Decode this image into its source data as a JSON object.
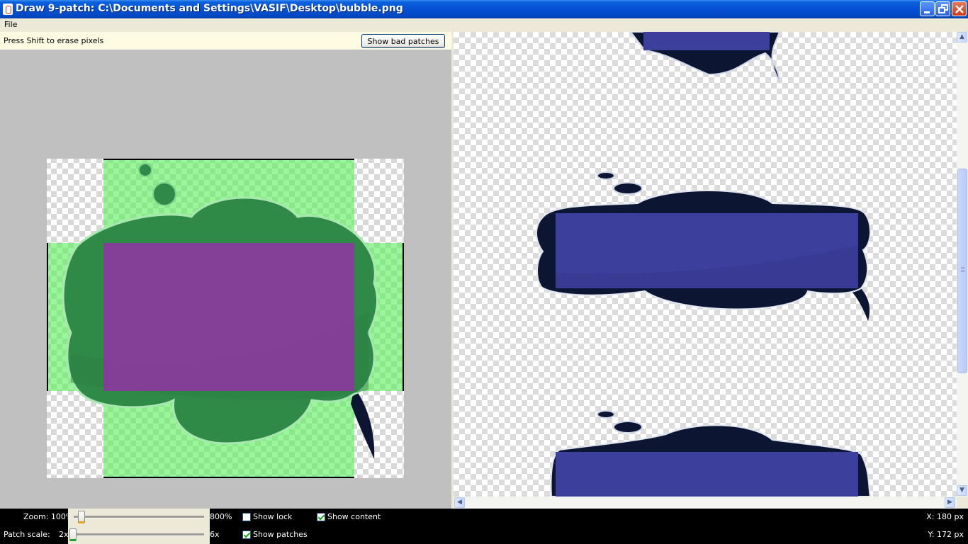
{
  "window": {
    "title": "Draw 9-patch: C:\\Documents and Settings\\VASIF\\Desktop\\bubble.png",
    "icon": "java-cup-icon"
  },
  "menubar": {
    "file_label": "File"
  },
  "editor": {
    "hint": "Press Shift to erase pixels",
    "bad_patches_button": "Show bad patches"
  },
  "status": {
    "zoom_label": "Zoom: 100%",
    "zoom_max": "800%",
    "zoom_level": 0.0,
    "patch_scale_label": "Patch scale:",
    "patch_min": "2x",
    "patch_max": "6x",
    "patch_level": 0.0,
    "show_lock_label": "Show lock",
    "show_lock_checked": false,
    "show_content_label": "Show content",
    "show_content_checked": true,
    "show_patches_label": "Show patches",
    "show_patches_checked": true,
    "x_label": "X: 180 px",
    "y_label": "Y: 172 px"
  },
  "colors": {
    "patch_green": "#80f080",
    "content_purple": "#8a3a9c",
    "bubble_green": "#2f8a48",
    "bubble_navy": "#0c1633",
    "content_blue": "#3d3f9c"
  }
}
